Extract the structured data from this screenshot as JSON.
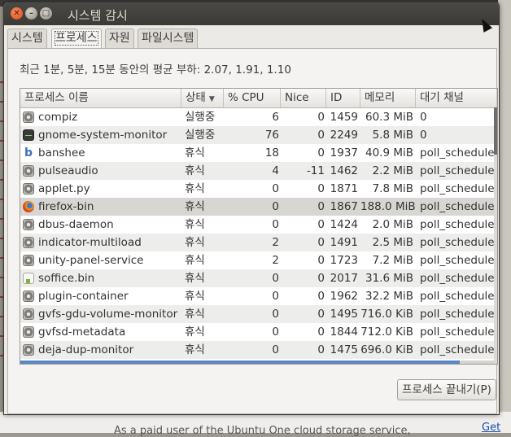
{
  "window": {
    "title": "시스템 감시"
  },
  "tabs": [
    {
      "label": "시스템"
    },
    {
      "label": "프로세스"
    },
    {
      "label": "자원"
    },
    {
      "label": "파일시스템"
    }
  ],
  "load_average": "최근 1분, 5분, 15분 동안의 평균 부하: 2.07, 1.91, 1.10",
  "columns": {
    "name": "프로세스 이름",
    "state": "상태",
    "cpu": "% CPU",
    "nice": "Nice",
    "id": "ID",
    "memory": "메모리",
    "wait_channel": "대기 채널"
  },
  "processes": [
    {
      "icon": "gear-icon",
      "name": "compiz",
      "state": "실행중",
      "cpu": "6",
      "nice": "0",
      "id": "1459",
      "memory": "60.3 MiB",
      "wait": "0"
    },
    {
      "icon": "monitor-icon",
      "name": "gnome-system-monitor",
      "state": "실행중",
      "cpu": "76",
      "nice": "0",
      "id": "2249",
      "memory": "5.8 MiB",
      "wait": "0"
    },
    {
      "icon": "banshee-icon",
      "name": "banshee",
      "state": "휴식",
      "cpu": "18",
      "nice": "0",
      "id": "1937",
      "memory": "40.9 MiB",
      "wait": "poll_schedule_t"
    },
    {
      "icon": "gear-icon",
      "name": "pulseaudio",
      "state": "휴식",
      "cpu": "4",
      "nice": "-11",
      "id": "1462",
      "memory": "2.2 MiB",
      "wait": "poll_schedule_t"
    },
    {
      "icon": "gear-icon",
      "name": "applet.py",
      "state": "휴식",
      "cpu": "0",
      "nice": "0",
      "id": "1871",
      "memory": "7.8 MiB",
      "wait": "poll_schedule_t"
    },
    {
      "icon": "firefox-icon",
      "name": "firefox-bin",
      "state": "휴식",
      "cpu": "0",
      "nice": "0",
      "id": "1867",
      "memory": "188.0 MiB",
      "wait": "poll_schedule_t"
    },
    {
      "icon": "gear-icon",
      "name": "dbus-daemon",
      "state": "휴식",
      "cpu": "0",
      "nice": "0",
      "id": "1424",
      "memory": "2.0 MiB",
      "wait": "poll_schedule_t"
    },
    {
      "icon": "gear-icon",
      "name": "indicator-multiload",
      "state": "휴식",
      "cpu": "2",
      "nice": "0",
      "id": "1491",
      "memory": "2.5 MiB",
      "wait": "poll_schedule_t"
    },
    {
      "icon": "gear-icon",
      "name": "unity-panel-service",
      "state": "휴식",
      "cpu": "2",
      "nice": "0",
      "id": "1723",
      "memory": "7.2 MiB",
      "wait": "poll_schedule_t"
    },
    {
      "icon": "soffice-icon",
      "name": "soffice.bin",
      "state": "휴식",
      "cpu": "0",
      "nice": "0",
      "id": "2017",
      "memory": "31.6 MiB",
      "wait": "poll_schedule_t"
    },
    {
      "icon": "gear-icon",
      "name": "plugin-container",
      "state": "휴식",
      "cpu": "0",
      "nice": "0",
      "id": "1962",
      "memory": "32.2 MiB",
      "wait": "poll_schedule_t"
    },
    {
      "icon": "gear-icon",
      "name": "gvfs-gdu-volume-monitor",
      "state": "휴식",
      "cpu": "0",
      "nice": "0",
      "id": "1495",
      "memory": "716.0 KiB",
      "wait": "poll_schedule_t"
    },
    {
      "icon": "gear-icon",
      "name": "gvfsd-metadata",
      "state": "휴식",
      "cpu": "0",
      "nice": "0",
      "id": "1844",
      "memory": "712.0 KiB",
      "wait": "poll_schedule_t"
    },
    {
      "icon": "gear-icon",
      "name": "deja-dup-monitor",
      "state": "휴식",
      "cpu": "0",
      "nice": "0",
      "id": "1475",
      "memory": "696.0 KiB",
      "wait": "poll_schedule_t"
    }
  ],
  "end_process_label": "프로세스 끝내기(P)",
  "background": {
    "bottom_text": "As a paid user of the Ubuntu One cloud storage service,",
    "bottom_link": "Get"
  },
  "colors": {
    "titlebar": "#3c3b37",
    "close_button": "#df4a16",
    "accent": "#5a86c5"
  }
}
